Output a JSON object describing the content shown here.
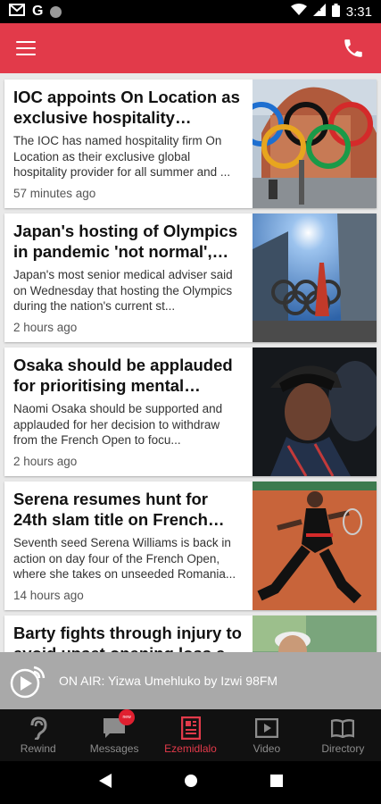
{
  "status_bar": {
    "time": "3:31",
    "left_icons": [
      "gmail-icon",
      "google-icon",
      "notification-dot-icon"
    ],
    "right_icons": [
      "wifi-icon",
      "signal-icon",
      "battery-icon"
    ],
    "google_letter": "G"
  },
  "app_bar": {
    "color": "#e23a4a",
    "left_icon": "menu-icon",
    "right_icon": "phone-icon"
  },
  "articles": [
    {
      "title": "IOC appoints On Location as exclusive hospitality provider...",
      "summary": "The IOC has named hospitality firm On Location as their exclusive global hospitality provider for all summer and ...",
      "time": "57 minutes ago",
      "image": "olympic-rings-building-image"
    },
    {
      "title": "Japan's hosting of Olympics in pandemic 'not normal', advis...",
      "summary": "Japan's most senior medical adviser said on Wednesday that hosting the Olympics during the nation's current st...",
      "time": "2 hours ago",
      "image": "olympic-rings-tokyo-image"
    },
    {
      "title": "Osaka should be applauded for prioritising mental health:...",
      "summary": "Naomi Osaka should be supported and applauded for her decision to withdraw from the French Open to focu...",
      "time": "2 hours ago",
      "image": "naomi-osaka-image"
    },
    {
      "title": "Serena resumes hunt for 24th slam title on French Open Da...",
      "summary": "Seventh seed Serena Williams is back in action on day four of the French Open, where she takes on unseeded Romania...",
      "time": "14 hours ago",
      "image": "serena-williams-image"
    },
    {
      "title": "Barty fights through injury to avoid upset opening loss at F...",
      "summary": "",
      "time": "",
      "image": "ashleigh-barty-image"
    }
  ],
  "on_air": {
    "text": "ON AIR: Yizwa Umehluko by Izwi 98FM",
    "icon": "radio-play-icon"
  },
  "bottom_nav": [
    {
      "label": "Rewind",
      "icon": "ear-icon",
      "active": false
    },
    {
      "label": "Messages",
      "icon": "chat-icon",
      "active": false,
      "badge": "new"
    },
    {
      "label": "Ezemidlalo",
      "icon": "newspaper-icon",
      "active": true
    },
    {
      "label": "Video",
      "icon": "video-icon",
      "active": false
    },
    {
      "label": "Directory",
      "icon": "book-icon",
      "active": false
    }
  ],
  "system_nav": [
    "back-icon",
    "home-icon",
    "recents-icon"
  ],
  "colors": {
    "accent": "#e23a4a",
    "on_air_bg": "#a9a9a9",
    "nav_bg": "#111111"
  }
}
